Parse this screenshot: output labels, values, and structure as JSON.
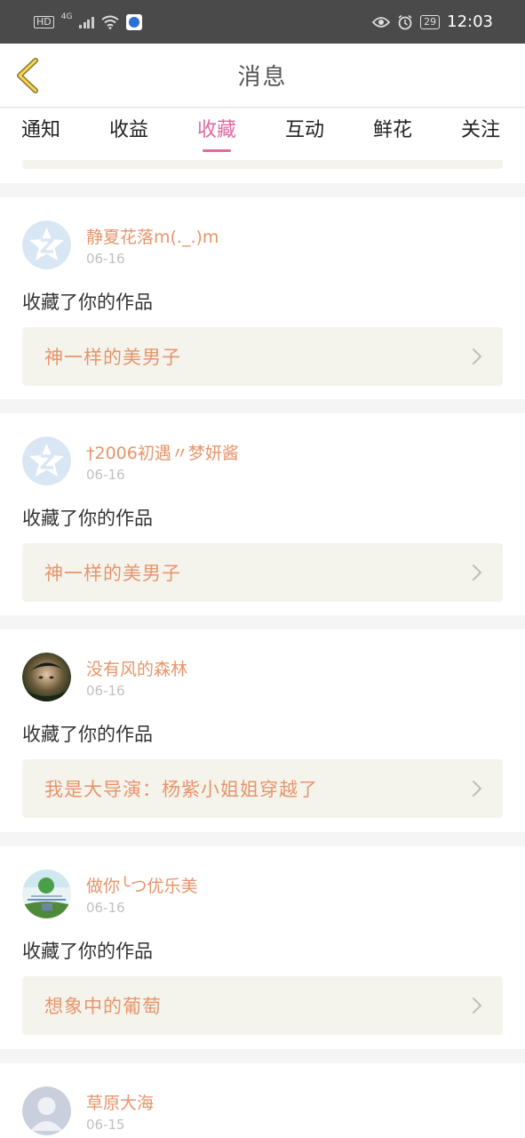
{
  "statusbar": {
    "hd": "HD",
    "network": "4G",
    "battery": "29",
    "time": "12:03"
  },
  "header": {
    "title": "消息"
  },
  "tabs": [
    {
      "label": "通知"
    },
    {
      "label": "收益"
    },
    {
      "label": "收藏"
    },
    {
      "label": "互动"
    },
    {
      "label": "鲜花"
    },
    {
      "label": "关注"
    }
  ],
  "active_tab": "收藏",
  "colors": {
    "accent_pink": "#e06aa1",
    "username_orange": "#e8946a",
    "work_box_bg": "#f5f4ec",
    "statusbar_bg": "#4a4a4a"
  },
  "items": [
    {
      "username": "静夏花落m(._.)m",
      "date": "06-16",
      "message": "收藏了你的作品",
      "work": "神一样的美男子",
      "avatar": "default-star-avatar"
    },
    {
      "username": "†2006初遇〃梦妍酱",
      "date": "06-16",
      "message": "收藏了你的作品",
      "work": "神一样的美男子",
      "avatar": "default-star-avatar"
    },
    {
      "username": "没有风的森林",
      "date": "06-16",
      "message": "收藏了你的作品",
      "work": "我是大导演：杨紫小姐姐穿越了",
      "avatar": "photo-avatar"
    },
    {
      "username": "做你╰つ优乐美",
      "date": "06-16",
      "message": "收藏了你的作品",
      "work": "想象中的葡萄",
      "avatar": "landscape-avatar"
    },
    {
      "username": "草原大海",
      "date": "06-15",
      "avatar": "default-person-avatar"
    }
  ]
}
